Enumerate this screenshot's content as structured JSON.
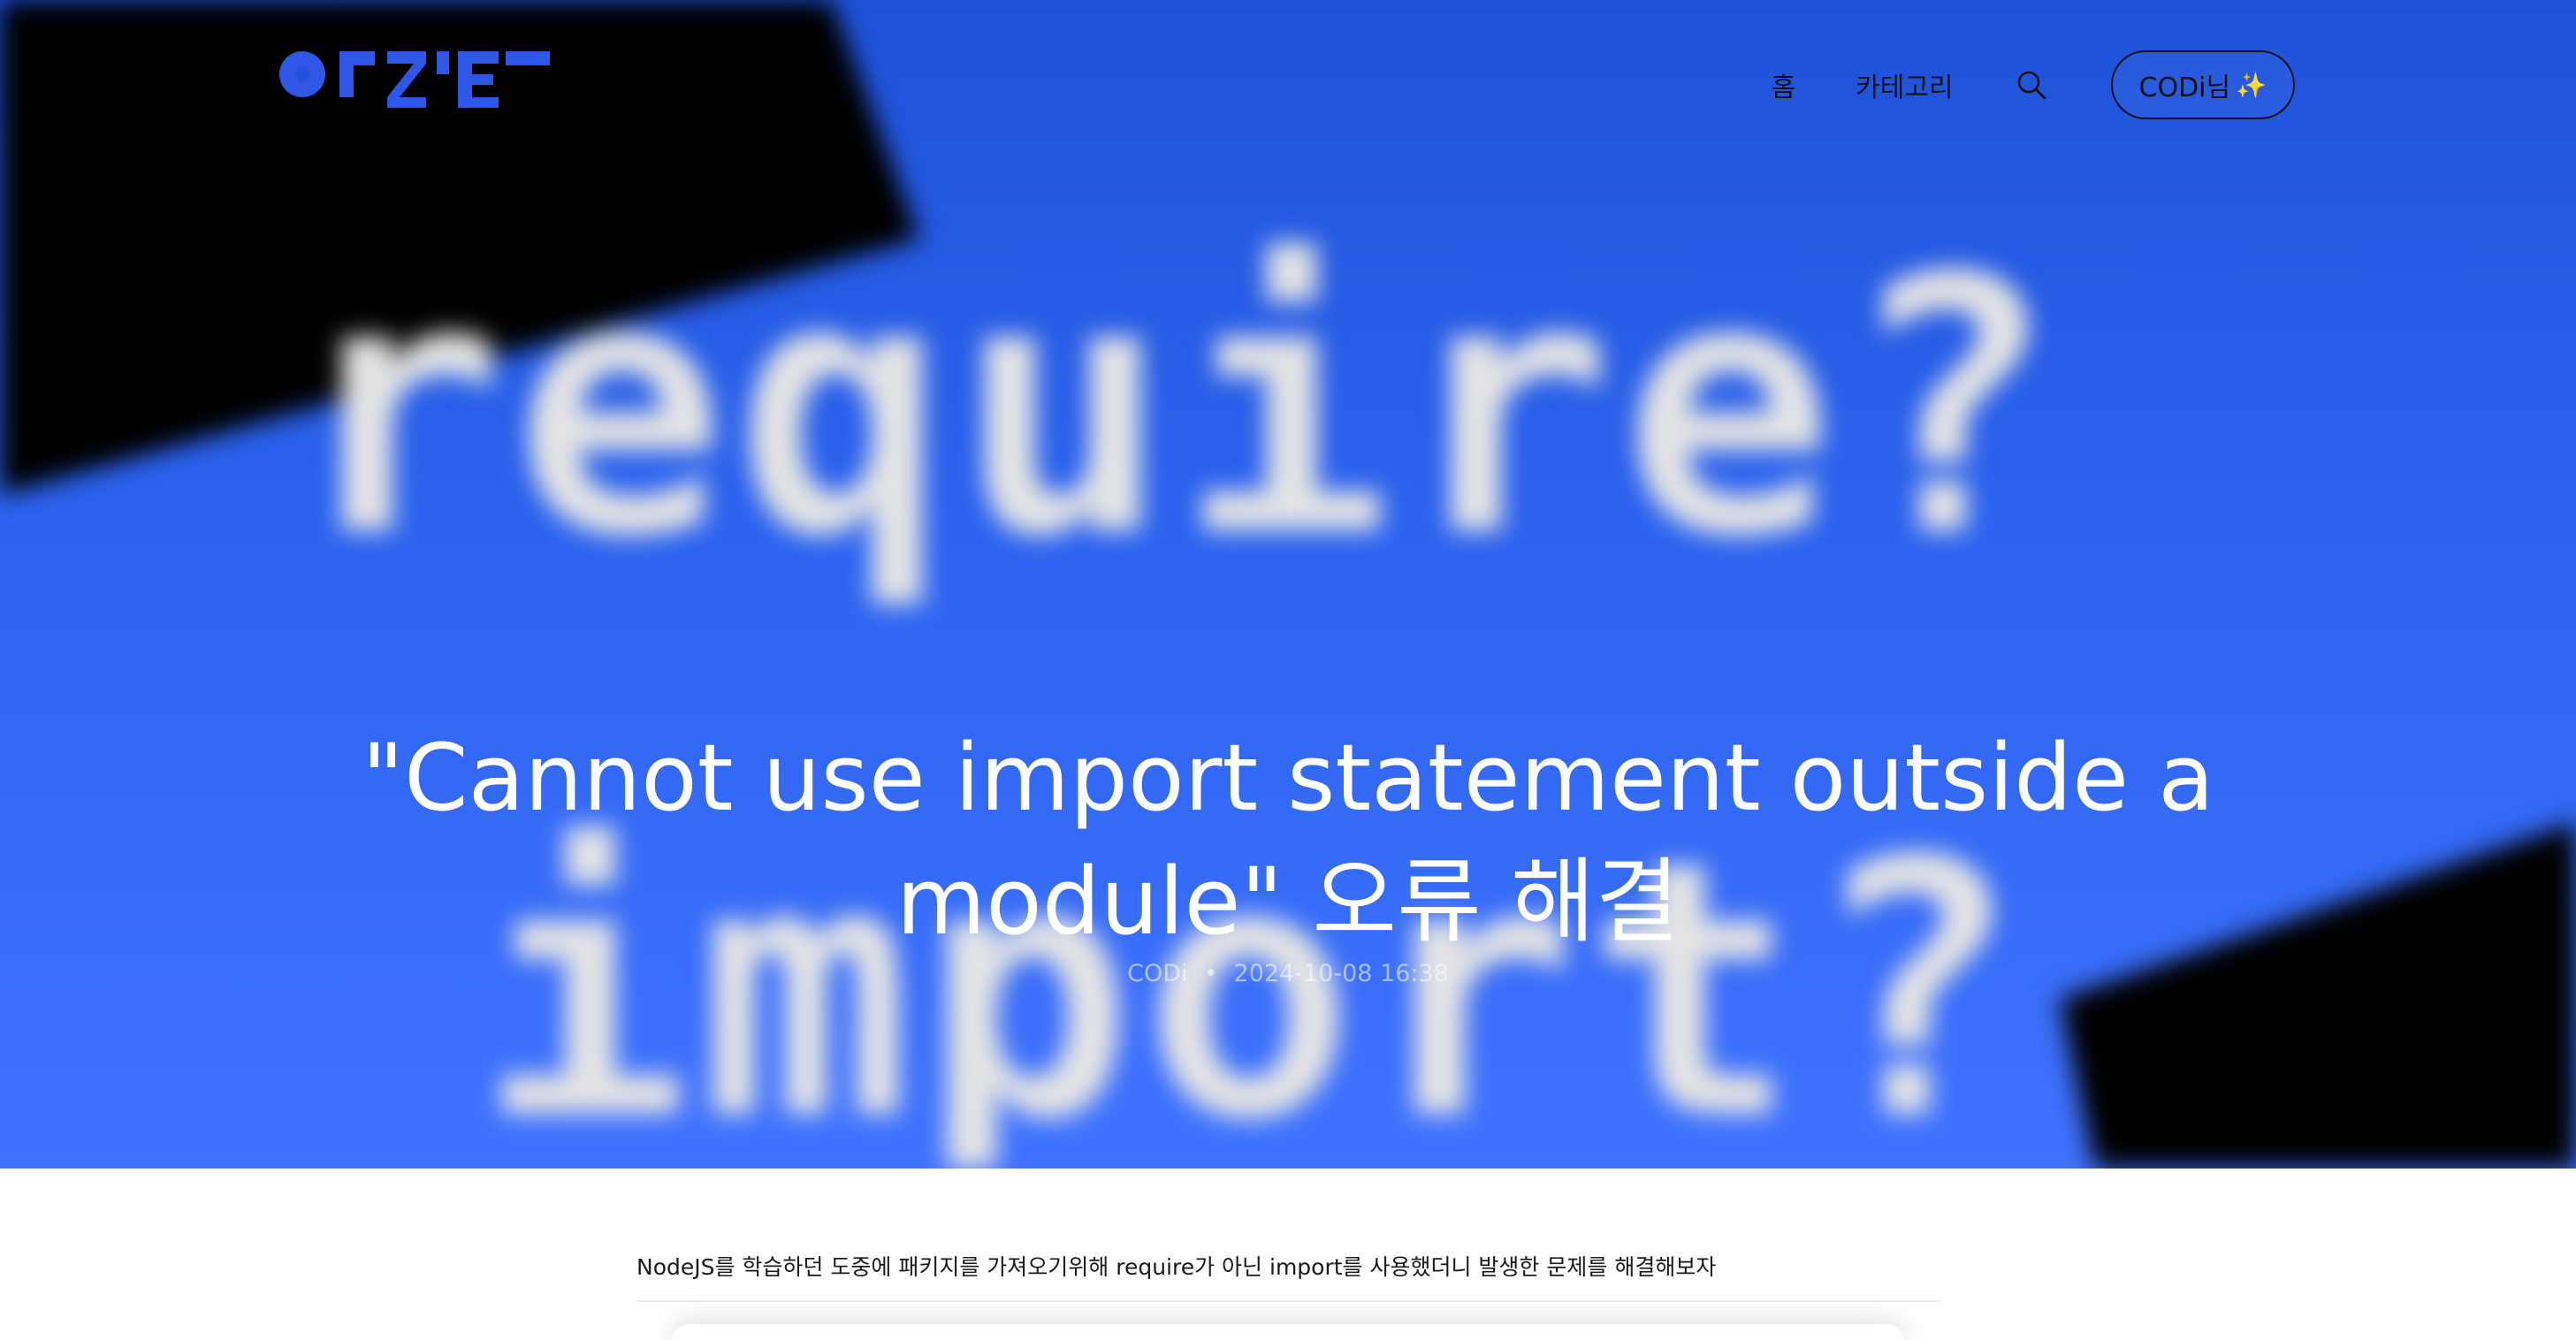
{
  "header": {
    "logo_text": "OFZIE",
    "nav": {
      "home_label": "홈",
      "category_label": "카테고리"
    },
    "user_button_label": "CODi님",
    "user_button_emoji": "✨"
  },
  "hero": {
    "background_words": [
      "require?",
      "import?"
    ],
    "title": "\"Cannot use import statement outside a module\" 오류 해결",
    "author": "CODi",
    "separator": "•",
    "date": "2024-10-08 16:38"
  },
  "content": {
    "intro": "NodeJS를 학습하던 도중에 패키지를 가져오기위해 require가 아닌 import를 사용했더니 발생한 문제를 해결해보자"
  },
  "colors": {
    "hero_blue": "#2c63ef",
    "logo_blue": "#2f57e6",
    "pixel_text": "#e6e6e6",
    "black_shape": "#000000"
  }
}
